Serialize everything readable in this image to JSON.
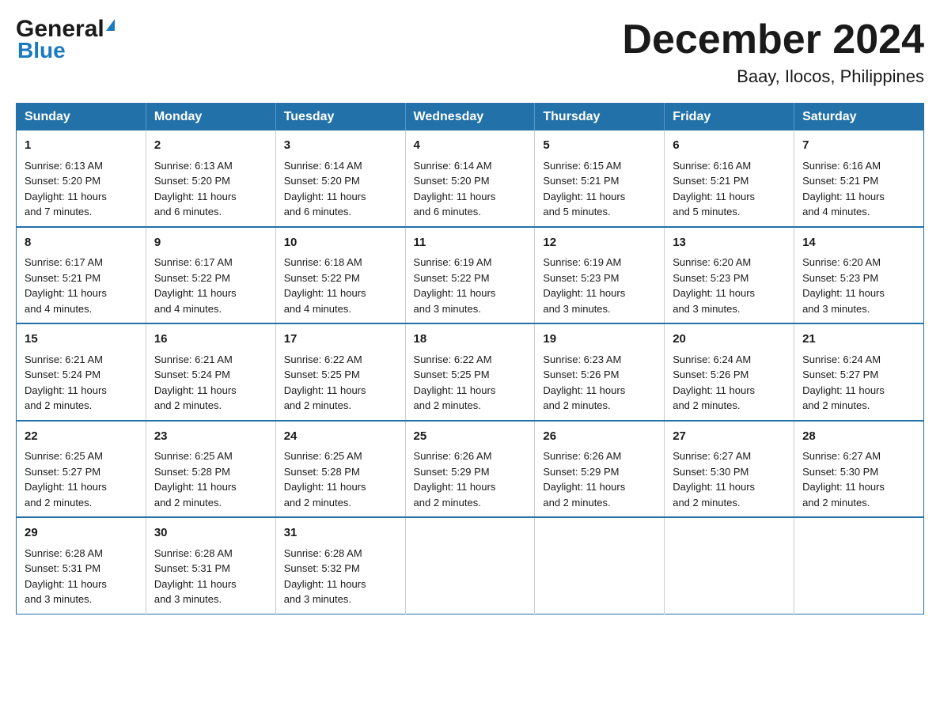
{
  "logo": {
    "general": "General",
    "blue": "Blue"
  },
  "title": "December 2024",
  "subtitle": "Baay, Ilocos, Philippines",
  "headers": [
    "Sunday",
    "Monday",
    "Tuesday",
    "Wednesday",
    "Thursday",
    "Friday",
    "Saturday"
  ],
  "weeks": [
    [
      {
        "day": "1",
        "sunrise": "6:13 AM",
        "sunset": "5:20 PM",
        "daylight": "11 hours and 7 minutes."
      },
      {
        "day": "2",
        "sunrise": "6:13 AM",
        "sunset": "5:20 PM",
        "daylight": "11 hours and 6 minutes."
      },
      {
        "day": "3",
        "sunrise": "6:14 AM",
        "sunset": "5:20 PM",
        "daylight": "11 hours and 6 minutes."
      },
      {
        "day": "4",
        "sunrise": "6:14 AM",
        "sunset": "5:20 PM",
        "daylight": "11 hours and 6 minutes."
      },
      {
        "day": "5",
        "sunrise": "6:15 AM",
        "sunset": "5:21 PM",
        "daylight": "11 hours and 5 minutes."
      },
      {
        "day": "6",
        "sunrise": "6:16 AM",
        "sunset": "5:21 PM",
        "daylight": "11 hours and 5 minutes."
      },
      {
        "day": "7",
        "sunrise": "6:16 AM",
        "sunset": "5:21 PM",
        "daylight": "11 hours and 4 minutes."
      }
    ],
    [
      {
        "day": "8",
        "sunrise": "6:17 AM",
        "sunset": "5:21 PM",
        "daylight": "11 hours and 4 minutes."
      },
      {
        "day": "9",
        "sunrise": "6:17 AM",
        "sunset": "5:22 PM",
        "daylight": "11 hours and 4 minutes."
      },
      {
        "day": "10",
        "sunrise": "6:18 AM",
        "sunset": "5:22 PM",
        "daylight": "11 hours and 4 minutes."
      },
      {
        "day": "11",
        "sunrise": "6:19 AM",
        "sunset": "5:22 PM",
        "daylight": "11 hours and 3 minutes."
      },
      {
        "day": "12",
        "sunrise": "6:19 AM",
        "sunset": "5:23 PM",
        "daylight": "11 hours and 3 minutes."
      },
      {
        "day": "13",
        "sunrise": "6:20 AM",
        "sunset": "5:23 PM",
        "daylight": "11 hours and 3 minutes."
      },
      {
        "day": "14",
        "sunrise": "6:20 AM",
        "sunset": "5:23 PM",
        "daylight": "11 hours and 3 minutes."
      }
    ],
    [
      {
        "day": "15",
        "sunrise": "6:21 AM",
        "sunset": "5:24 PM",
        "daylight": "11 hours and 2 minutes."
      },
      {
        "day": "16",
        "sunrise": "6:21 AM",
        "sunset": "5:24 PM",
        "daylight": "11 hours and 2 minutes."
      },
      {
        "day": "17",
        "sunrise": "6:22 AM",
        "sunset": "5:25 PM",
        "daylight": "11 hours and 2 minutes."
      },
      {
        "day": "18",
        "sunrise": "6:22 AM",
        "sunset": "5:25 PM",
        "daylight": "11 hours and 2 minutes."
      },
      {
        "day": "19",
        "sunrise": "6:23 AM",
        "sunset": "5:26 PM",
        "daylight": "11 hours and 2 minutes."
      },
      {
        "day": "20",
        "sunrise": "6:24 AM",
        "sunset": "5:26 PM",
        "daylight": "11 hours and 2 minutes."
      },
      {
        "day": "21",
        "sunrise": "6:24 AM",
        "sunset": "5:27 PM",
        "daylight": "11 hours and 2 minutes."
      }
    ],
    [
      {
        "day": "22",
        "sunrise": "6:25 AM",
        "sunset": "5:27 PM",
        "daylight": "11 hours and 2 minutes."
      },
      {
        "day": "23",
        "sunrise": "6:25 AM",
        "sunset": "5:28 PM",
        "daylight": "11 hours and 2 minutes."
      },
      {
        "day": "24",
        "sunrise": "6:25 AM",
        "sunset": "5:28 PM",
        "daylight": "11 hours and 2 minutes."
      },
      {
        "day": "25",
        "sunrise": "6:26 AM",
        "sunset": "5:29 PM",
        "daylight": "11 hours and 2 minutes."
      },
      {
        "day": "26",
        "sunrise": "6:26 AM",
        "sunset": "5:29 PM",
        "daylight": "11 hours and 2 minutes."
      },
      {
        "day": "27",
        "sunrise": "6:27 AM",
        "sunset": "5:30 PM",
        "daylight": "11 hours and 2 minutes."
      },
      {
        "day": "28",
        "sunrise": "6:27 AM",
        "sunset": "5:30 PM",
        "daylight": "11 hours and 2 minutes."
      }
    ],
    [
      {
        "day": "29",
        "sunrise": "6:28 AM",
        "sunset": "5:31 PM",
        "daylight": "11 hours and 3 minutes."
      },
      {
        "day": "30",
        "sunrise": "6:28 AM",
        "sunset": "5:31 PM",
        "daylight": "11 hours and 3 minutes."
      },
      {
        "day": "31",
        "sunrise": "6:28 AM",
        "sunset": "5:32 PM",
        "daylight": "11 hours and 3 minutes."
      },
      null,
      null,
      null,
      null
    ]
  ],
  "labels": {
    "sunrise": "Sunrise:",
    "sunset": "Sunset:",
    "daylight": "Daylight:"
  }
}
